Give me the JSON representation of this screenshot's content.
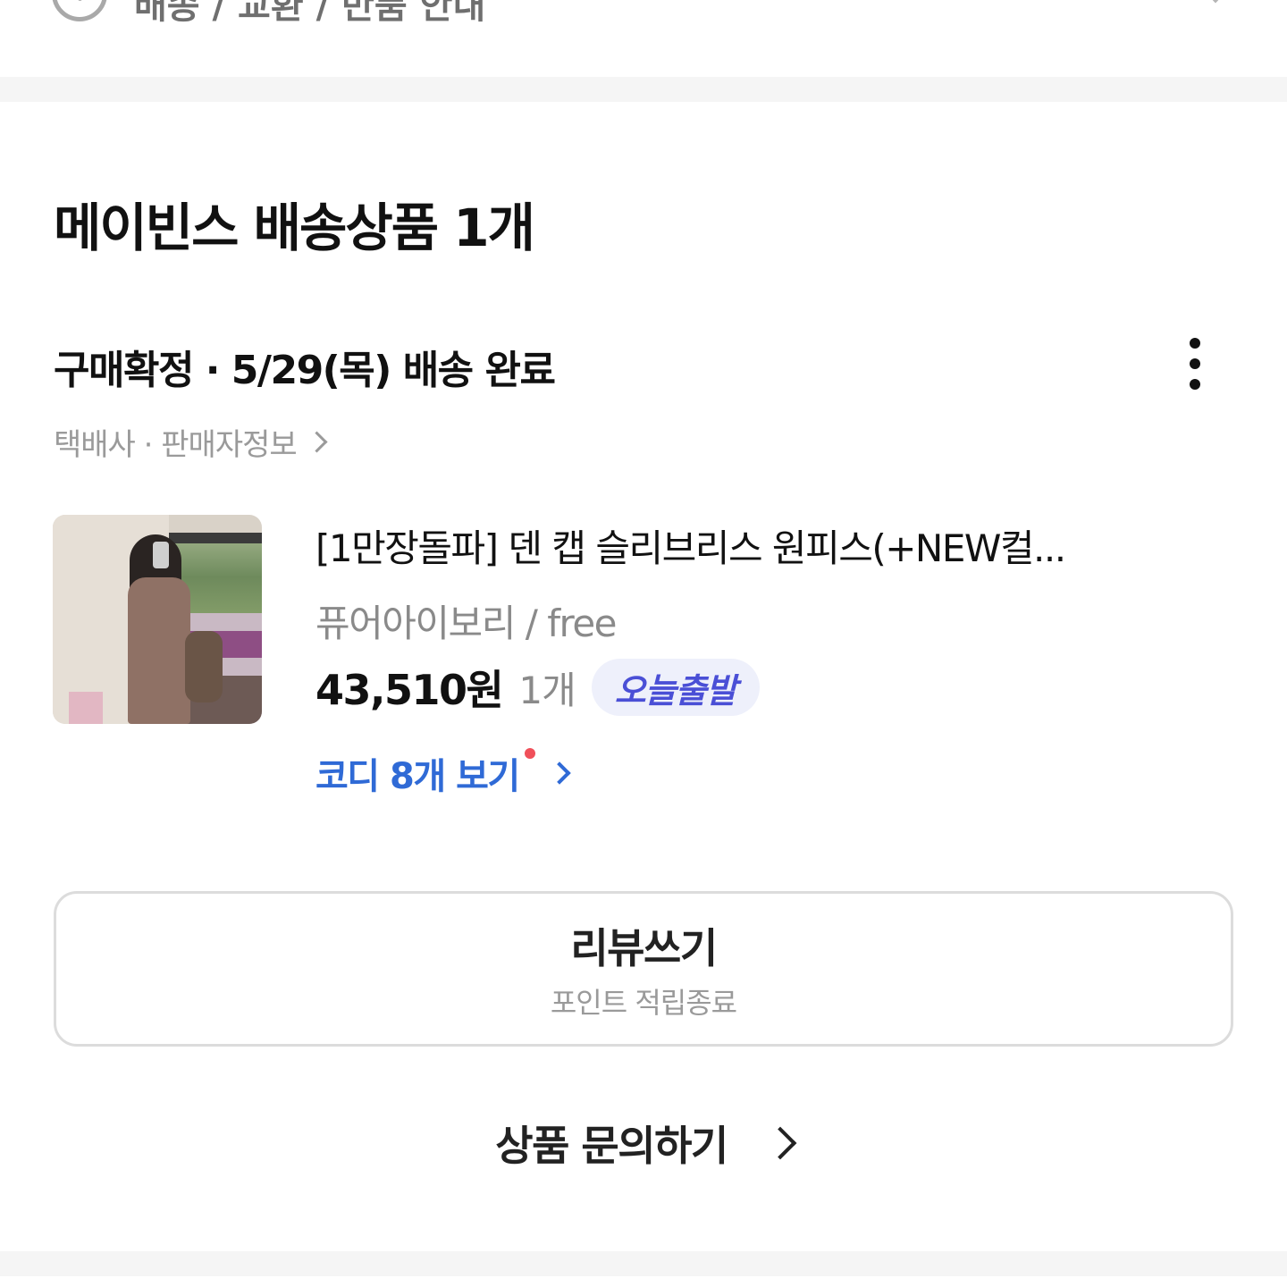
{
  "top_row": {
    "label": "배송 / 교환 / 반품 안내",
    "icon": "info-circle-icon"
  },
  "section": {
    "title": "메이빈스 배송상품 1개"
  },
  "order": {
    "status": "구매확정 · 5/29(목) 배송 완료",
    "sub_info": "택배사 · 판매자정보",
    "more_icon": "more-vertical-icon"
  },
  "product": {
    "name": "[1만장돌파] 덴 캡 슬리브리스 원피스(+NEW컬...",
    "option": "퓨어아이보리 / free",
    "price": "43,510원",
    "quantity": "1개",
    "badge": "오늘출발",
    "badge_color": "#4a4fd6",
    "codi_link": "코디 8개 보기",
    "link_color": "#2f6ad6",
    "dot_color": "#f0505a"
  },
  "review_button": {
    "label": "리뷰쓰기",
    "sub": "포인트 적립종료"
  },
  "inquiry": {
    "label": "상품 문의하기"
  }
}
